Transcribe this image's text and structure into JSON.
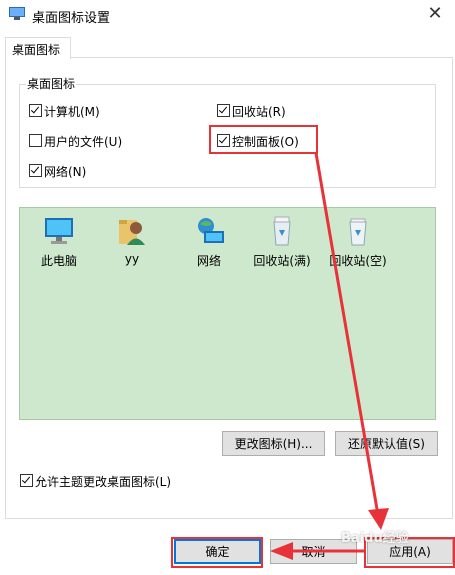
{
  "window": {
    "title": "桌面图标设置",
    "close_glyph": "✕"
  },
  "tab": {
    "label": "桌面图标"
  },
  "group": {
    "label": "桌面图标",
    "checkboxes": [
      {
        "label": "计算机(M)",
        "checked": true
      },
      {
        "label": "回收站(R)",
        "checked": true
      },
      {
        "label": "用户的文件(U)",
        "checked": false
      },
      {
        "label": "控制面板(O)",
        "checked": true
      },
      {
        "label": "网络(N)",
        "checked": true
      }
    ]
  },
  "preview": {
    "icons": [
      {
        "label": "此电脑",
        "icon": "computer-icon"
      },
      {
        "label": "yy",
        "icon": "user-folder-icon"
      },
      {
        "label": "网络",
        "icon": "network-icon"
      },
      {
        "label": "回收站(满)",
        "icon": "recycle-bin-full-icon"
      },
      {
        "label": "回收站(空)",
        "icon": "recycle-bin-empty-icon"
      }
    ],
    "background_color": "#cde8cd"
  },
  "buttons": {
    "change_icon": "更改图标(H)...",
    "restore_default": "还原默认值(S)",
    "ok": "确定",
    "cancel": "取消",
    "apply": "应用(A)"
  },
  "theme_checkbox": {
    "label": "允许主题更改桌面图标(L)",
    "checked": true
  },
  "annotation": {
    "color": "#e8323a"
  },
  "watermark": "Baidu经验"
}
